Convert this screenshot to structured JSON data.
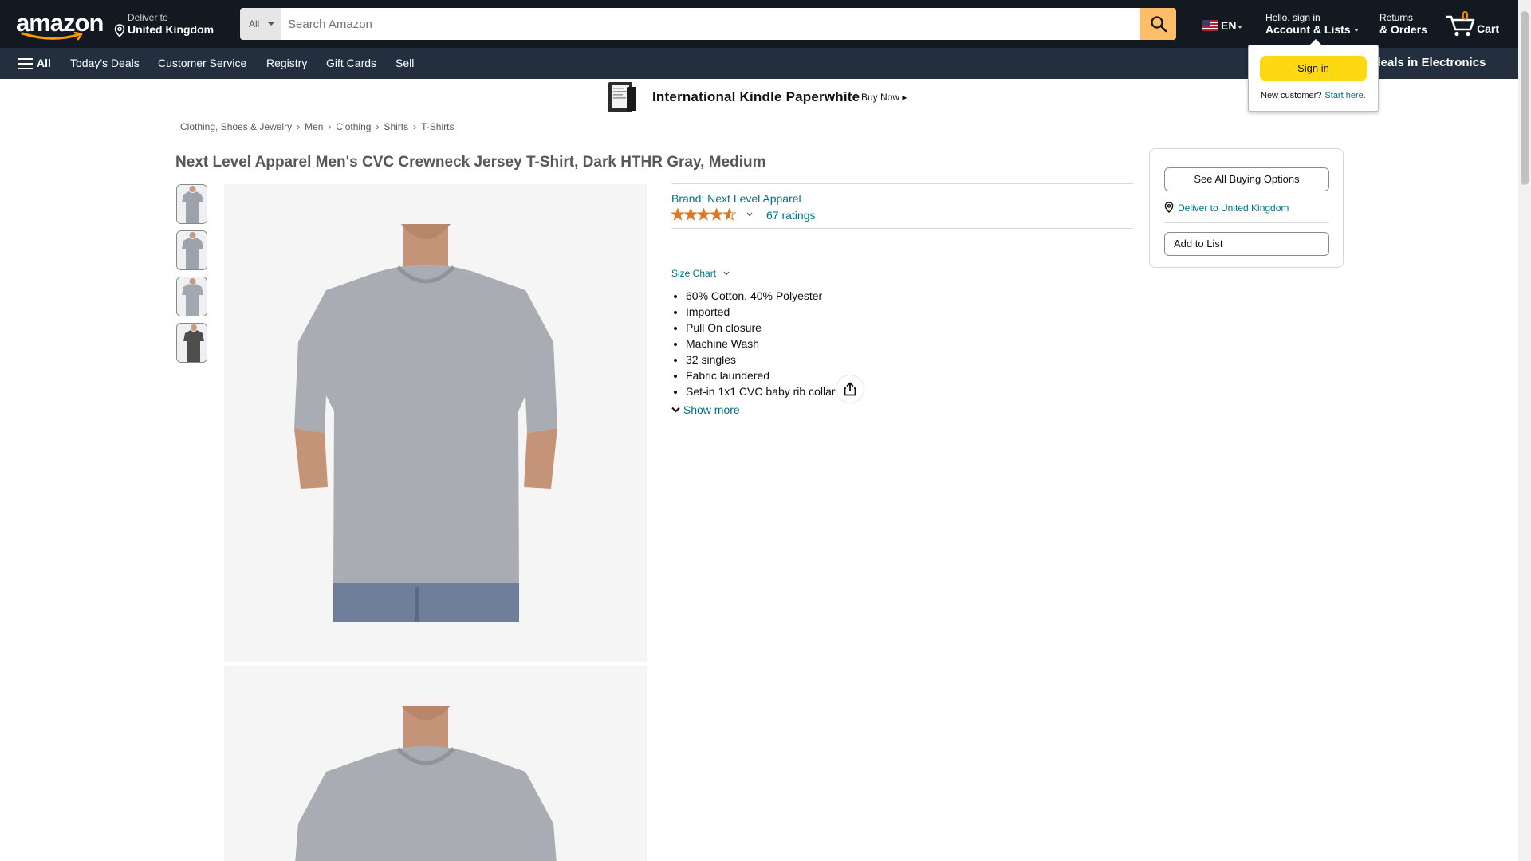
{
  "header": {
    "logo": "amazon",
    "deliver_line1": "Deliver to",
    "deliver_line2": "United Kingdom",
    "search_category": "All",
    "search_placeholder": "Search Amazon",
    "language": "EN",
    "account_line1": "Hello, sign in",
    "account_line2": "Account & Lists",
    "returns_line1": "Returns",
    "returns_line2": "& Orders",
    "cart_count": "0",
    "cart_label": "Cart"
  },
  "subnav": {
    "all_label": "All",
    "items": [
      "Today's Deals",
      "Customer Service",
      "Registry",
      "Gift Cards",
      "Sell"
    ],
    "promo": "op deals in Electronics"
  },
  "banner": {
    "title": "International Kindle Paperwhite",
    "cta": "Buy Now ▸"
  },
  "signin_flyout": {
    "button": "Sign in",
    "new_customer": "New customer?",
    "start_here": "Start here."
  },
  "breadcrumb": [
    "Clothing, Shoes & Jewelry",
    "Men",
    "Clothing",
    "Shirts",
    "T-Shirts"
  ],
  "product": {
    "title": "Next Level Apparel Men's CVC Crewneck Jersey T-Shirt, Dark HTHR Gray, Medium",
    "brand": "Brand: Next Level Apparel",
    "rating_stars": 4.5,
    "ratings_count": "67 ratings",
    "size_chart": "Size Chart",
    "bullets": [
      "60% Cotton, 40% Polyester",
      "Imported",
      "Pull On closure",
      "Machine Wash",
      "32 singles",
      "Fabric laundered",
      "Set-in 1x1 CVC baby rib collar"
    ],
    "show_more": "Show more"
  },
  "buybox": {
    "see_all": "See All Buying Options",
    "deliver": "Deliver to United Kingdom",
    "add_to_list": "Add to List"
  },
  "colors": {
    "nav_dark": "#131921",
    "nav_sub": "#232f3e",
    "search_button": "#febd69",
    "signin_button": "#ffd814",
    "link": "#007185",
    "star": "#de7921",
    "cart_count": "#f08804"
  },
  "icons": {
    "location": "location-pin-icon",
    "search": "search-icon",
    "cart": "cart-icon",
    "menu": "hamburger-menu-icon",
    "share": "share-icon",
    "flag": "us-flag-icon"
  }
}
